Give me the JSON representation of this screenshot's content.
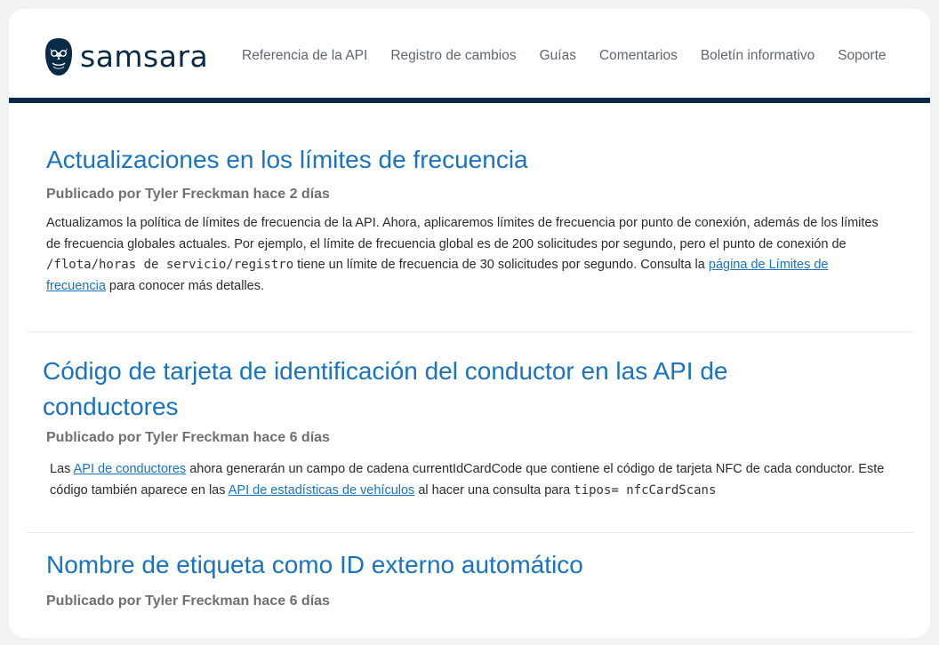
{
  "brand": {
    "name": "samsara",
    "colors": {
      "navy": "#0b2a45",
      "link": "#1a73c0"
    }
  },
  "nav": {
    "items": [
      "Referencia de la API",
      "Registro de cambios",
      "Guías",
      "Comentarios",
      "Boletín informativo",
      "Soporte"
    ]
  },
  "posts": [
    {
      "title": "Actualizaciones en los límites de frecuencia",
      "byline": "Publicado por Tyler Freckman hace 2 días",
      "body": {
        "p1": "Actualizamos la política de límites de frecuencia de la API. Ahora, aplicaremos límites de frecuencia por punto de conexión, además de los límites de frecuencia globales actuales. Por ejemplo, el límite de frecuencia global es de 200 solicitudes por segundo, pero el punto de conexión de ",
        "code": "/flota/horas de servicio/registro",
        "p2": " tiene un límite de frecuencia de 30 solicitudes por segundo. Consulta la ",
        "link": "página de Límites de frecuencia",
        "p3": " para conocer más detalles."
      }
    },
    {
      "title": "Código de tarjeta de identificación del conductor en las API de conductores",
      "byline": "Publicado por Tyler Freckman hace 6 días",
      "body": {
        "p1": "Las ",
        "link1": "API de conductores",
        "p2": " ahora generarán un campo de cadena currentIdCardCode que contiene el código de tarjeta NFC de cada conductor. Este código también aparece en las ",
        "link2": "API de estadísticas de vehículos",
        "p3": " al hacer una consulta para ",
        "code": "tipos= nfcCardScans"
      }
    },
    {
      "title": "Nombre de etiqueta como ID externo automático",
      "byline": "Publicado por Tyler Freckman hace 6 días"
    }
  ]
}
